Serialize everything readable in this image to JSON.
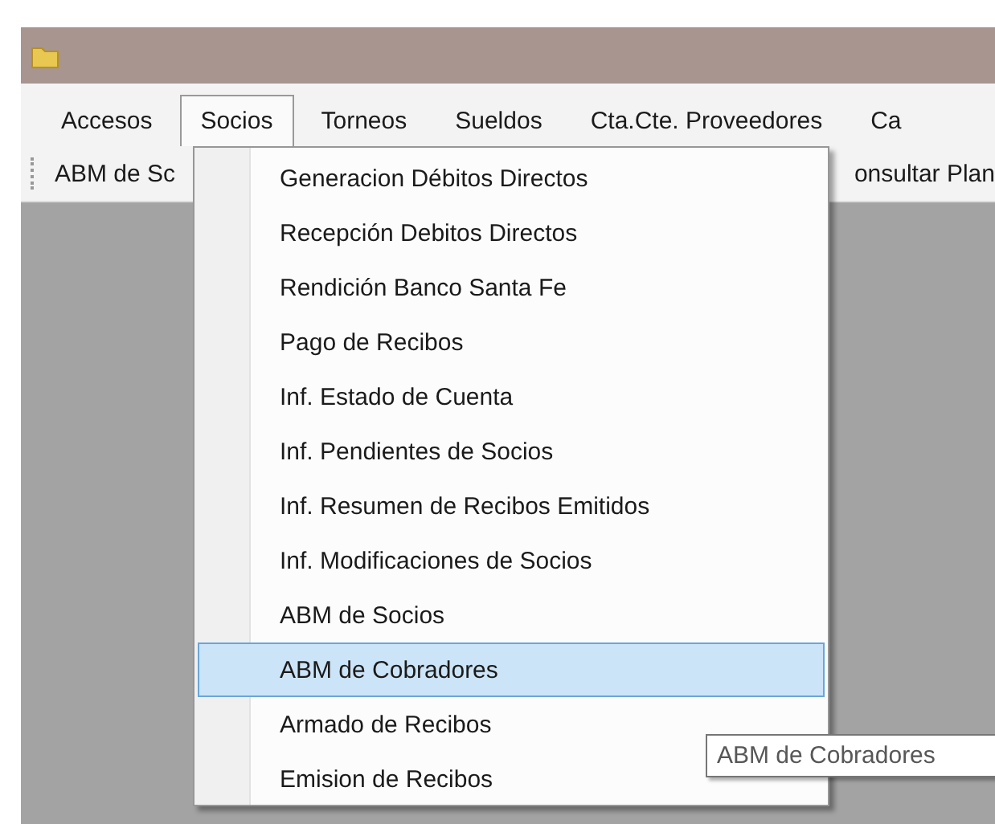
{
  "menu_bar": [
    {
      "label": "Accesos",
      "selected": false
    },
    {
      "label": "Socios",
      "selected": true
    },
    {
      "label": "Torneos",
      "selected": false
    },
    {
      "label": "Sueldos",
      "selected": false
    },
    {
      "label": "Cta.Cte. Proveedores",
      "selected": false
    },
    {
      "label": "Ca",
      "selected": false
    }
  ],
  "toolbar": [
    "ABM de Sc",
    "onsultar Plan"
  ],
  "dropdown": [
    {
      "label": "Generacion Débitos Directos",
      "selected": false
    },
    {
      "label": "Recepción Debitos Directos",
      "selected": false
    },
    {
      "label": "Rendición Banco Santa Fe",
      "selected": false
    },
    {
      "label": "Pago de Recibos",
      "selected": false
    },
    {
      "label": "Inf. Estado de Cuenta",
      "selected": false
    },
    {
      "label": "Inf. Pendientes de Socios",
      "selected": false
    },
    {
      "label": "Inf. Resumen de Recibos Emitidos",
      "selected": false
    },
    {
      "label": "Inf. Modificaciones de Socios",
      "selected": false
    },
    {
      "label": "ABM de Socios",
      "selected": false
    },
    {
      "label": "ABM de Cobradores",
      "selected": true
    },
    {
      "label": "Armado de Recibos",
      "selected": false
    },
    {
      "label": "Emision de Recibos",
      "selected": false
    }
  ],
  "tooltip": "ABM de Cobradores"
}
